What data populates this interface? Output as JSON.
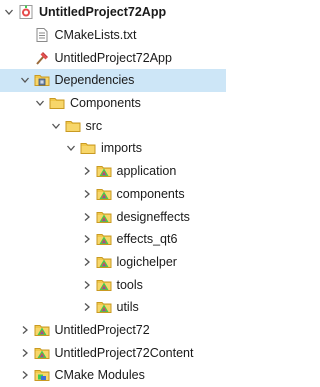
{
  "tree": {
    "items": [
      {
        "label": "UntitledProject72App",
        "indent": 0,
        "expand": "expanded",
        "icon": "qt-project-icon",
        "bold": true,
        "selected": false
      },
      {
        "label": "CMakeLists.txt",
        "indent": 1,
        "expand": "none",
        "icon": "text-file-icon",
        "bold": false,
        "selected": false
      },
      {
        "label": "UntitledProject72App",
        "indent": 1,
        "expand": "none",
        "icon": "build-hammer-icon",
        "bold": false,
        "selected": false
      },
      {
        "label": "Dependencies",
        "indent": 1,
        "expand": "expanded",
        "icon": "module-folder-icon",
        "bold": false,
        "selected": true
      },
      {
        "label": "Components",
        "indent": 2,
        "expand": "expanded",
        "icon": "folder-icon",
        "bold": false,
        "selected": false
      },
      {
        "label": "src",
        "indent": 3,
        "expand": "expanded",
        "icon": "folder-icon",
        "bold": false,
        "selected": false
      },
      {
        "label": "imports",
        "indent": 4,
        "expand": "expanded",
        "icon": "folder-icon",
        "bold": false,
        "selected": false
      },
      {
        "label": "application",
        "indent": 5,
        "expand": "collapsed",
        "icon": "qt-module-folder-icon",
        "bold": false,
        "selected": false
      },
      {
        "label": "components",
        "indent": 5,
        "expand": "collapsed",
        "icon": "qt-module-folder-icon",
        "bold": false,
        "selected": false
      },
      {
        "label": "designeffects",
        "indent": 5,
        "expand": "collapsed",
        "icon": "qt-module-folder-icon",
        "bold": false,
        "selected": false
      },
      {
        "label": "effects_qt6",
        "indent": 5,
        "expand": "collapsed",
        "icon": "qt-module-folder-icon",
        "bold": false,
        "selected": false
      },
      {
        "label": "logichelper",
        "indent": 5,
        "expand": "collapsed",
        "icon": "qt-module-folder-icon",
        "bold": false,
        "selected": false
      },
      {
        "label": "tools",
        "indent": 5,
        "expand": "collapsed",
        "icon": "qt-module-folder-icon",
        "bold": false,
        "selected": false
      },
      {
        "label": "utils",
        "indent": 5,
        "expand": "collapsed",
        "icon": "qt-module-folder-icon",
        "bold": false,
        "selected": false
      },
      {
        "label": "UntitledProject72",
        "indent": 1,
        "expand": "collapsed",
        "icon": "qt-module-folder-icon",
        "bold": false,
        "selected": false
      },
      {
        "label": "UntitledProject72Content",
        "indent": 1,
        "expand": "collapsed",
        "icon": "qt-module-folder-icon",
        "bold": false,
        "selected": false
      },
      {
        "label": "CMake Modules",
        "indent": 1,
        "expand": "collapsed",
        "icon": "cmake-folder-icon",
        "bold": false,
        "selected": false
      }
    ]
  },
  "colors": {
    "selection": "#cde6f7",
    "folder": "#f1c84b",
    "folder_dark": "#c99a22",
    "qt_green": "#41cd52",
    "qt_red": "#e64a4a",
    "qt_blue": "#3d6fd8",
    "arrow": "#555555"
  }
}
